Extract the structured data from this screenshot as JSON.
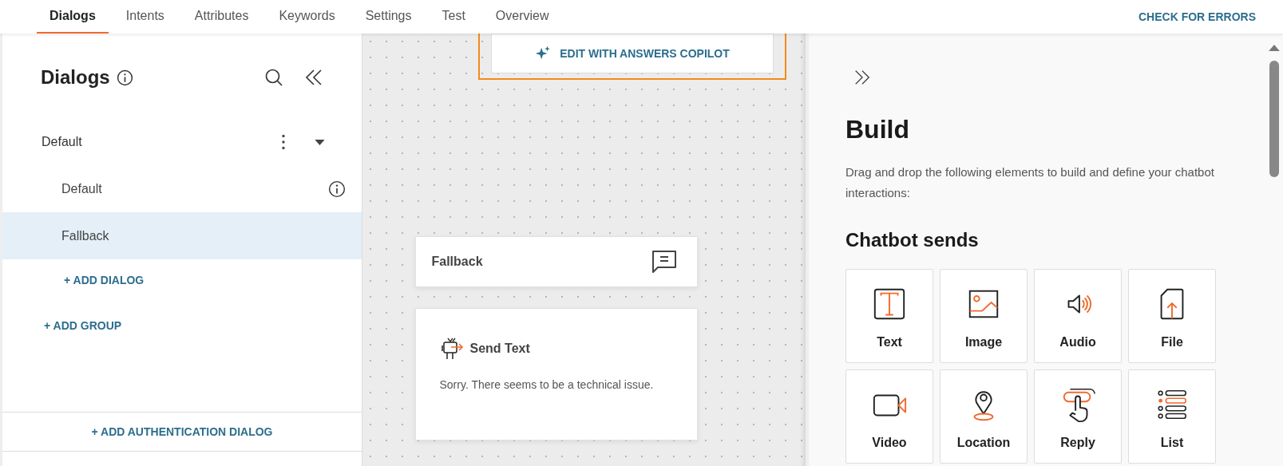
{
  "tabs": [
    {
      "label": "Dialogs",
      "selected": true
    },
    {
      "label": "Intents",
      "selected": false
    },
    {
      "label": "Attributes",
      "selected": false
    },
    {
      "label": "Keywords",
      "selected": false
    },
    {
      "label": "Settings",
      "selected": false
    },
    {
      "label": "Test",
      "selected": false
    },
    {
      "label": "Overview",
      "selected": false
    }
  ],
  "header_action": "CHECK FOR ERRORS",
  "sidebar": {
    "title": "Dialogs",
    "groups": [
      {
        "name": "Default",
        "expanded": true,
        "dialogs": [
          {
            "label": "Default",
            "selected": false,
            "info": true
          },
          {
            "label": "Fallback",
            "selected": true,
            "info": false
          }
        ],
        "add_dialog": "+ ADD DIALOG"
      }
    ],
    "add_group": "+ ADD GROUP",
    "add_authentication": "+ ADD AUTHENTICATION DIALOG"
  },
  "canvas": {
    "copilot_button": "EDIT WITH ANSWERS COPILOT",
    "nodes": [
      {
        "kind": "header",
        "title": "Fallback"
      },
      {
        "kind": "message",
        "title": "Send Text",
        "text": "Sorry. There seems to be a technical issue."
      }
    ]
  },
  "build_panel": {
    "title": "Build",
    "description": "Drag and drop the following elements to build and define your chatbot interactions:",
    "section": "Chatbot sends",
    "elements": [
      {
        "kind": "text",
        "label": "Text"
      },
      {
        "kind": "image",
        "label": "Image"
      },
      {
        "kind": "audio",
        "label": "Audio"
      },
      {
        "kind": "file",
        "label": "File"
      },
      {
        "kind": "video",
        "label": "Video"
      },
      {
        "kind": "location",
        "label": "Location"
      },
      {
        "kind": "reply",
        "label": "Reply"
      },
      {
        "kind": "list",
        "label": "List"
      }
    ]
  }
}
